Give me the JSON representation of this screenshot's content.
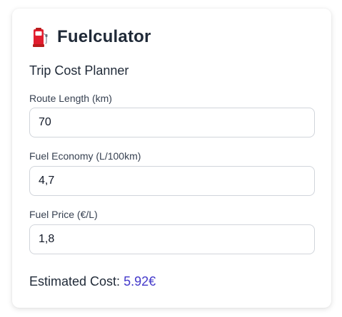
{
  "app": {
    "title": "Fuelculator",
    "icon": "fuel-pump-icon",
    "accent_color": "#4338ca",
    "icon_color": "#e11d2e"
  },
  "planner": {
    "subtitle": "Trip Cost Planner",
    "fields": [
      {
        "label": "Route Length (km)",
        "value": "70"
      },
      {
        "label": "Fuel Economy (L/100km)",
        "value": "4,7"
      },
      {
        "label": "Fuel Price (€/L)",
        "value": "1,8"
      }
    ],
    "result_label": "Estimated Cost:",
    "result_value": "5.92€"
  }
}
